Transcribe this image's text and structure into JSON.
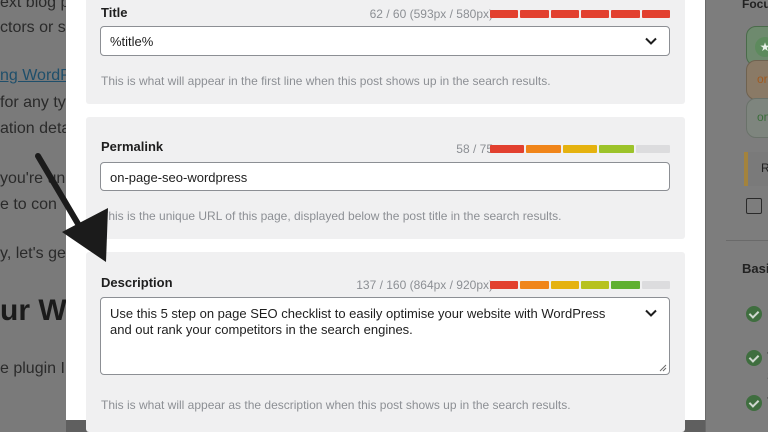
{
  "background_editor": {
    "lines": [
      {
        "text": "ext blog p"
      },
      {
        "text": "ctors or st"
      },
      {
        "text": "ng WordPr",
        "link": true
      },
      {
        "text": "for any ty"
      },
      {
        "text": "ation deta"
      },
      {
        "text": "you're una"
      },
      {
        "text": "e to con"
      },
      {
        "text": "y, let's ge"
      },
      {
        "text": "ur Wo",
        "heading": true
      },
      {
        "text": "e plugin I"
      }
    ]
  },
  "background_sidebar": {
    "focus_label": "Focu",
    "pill_orange": "or",
    "pill_grey": "on",
    "re_label": "Re",
    "basi_label": "Basi",
    "rows": [
      "H",
      "T",
      "T"
    ],
    "rows2": [
      "",
      "S",
      "L"
    ]
  },
  "title_panel": {
    "label": "Title",
    "count": "62 / 60 (593px / 580px)",
    "meter_colors": [
      "#e2402f",
      "#e2402f",
      "#e2402f",
      "#e2402f",
      "#e2402f",
      "#e2402f"
    ],
    "value": "%title%",
    "help": "This is what will appear in the first line when this post shows up in the search results."
  },
  "permalink_panel": {
    "label": "Permalink",
    "count": "58 / 75",
    "meter_colors": [
      "#e2402f",
      "#f0851a",
      "#e5b20f",
      "#9cc32a",
      "#dcdcde"
    ],
    "value": "on-page-seo-wordpress",
    "help": "This is the unique URL of this page, displayed below the post title in the search results."
  },
  "description_panel": {
    "label": "Description",
    "count": "137 / 160 (864px / 920px)",
    "meter_colors": [
      "#e2402f",
      "#f0851a",
      "#e5b20f",
      "#b7c21e",
      "#5fb031",
      "#dcdcde"
    ],
    "value_line1": "Use this 5 step on page SEO checklist to easily optimise your website with WordPress",
    "value_line2": "and out rank your competitors in the search engines.",
    "help": "This is what will appear as the description when this post shows up in the search results."
  },
  "colors": {
    "modal_bg": "#ffffff",
    "panel_bg": "#f0f0f1",
    "muted_text": "#8c8f94",
    "input_border": "#8c8f94"
  }
}
